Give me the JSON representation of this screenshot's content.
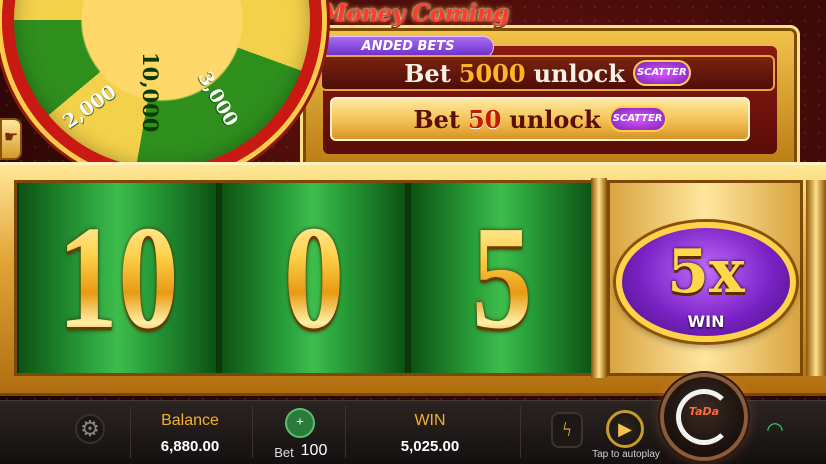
{
  "header": {
    "title": "Money Coming",
    "subtitle": "ANDED BETS"
  },
  "wheel": {
    "segments": [
      "2,000",
      "10,000",
      "3,000"
    ]
  },
  "unlock_rows": [
    {
      "prefix": "Bet",
      "amount": "5000",
      "suffix": "unlock",
      "badge": "SCATTER"
    },
    {
      "prefix": "Bet",
      "amount": "50",
      "suffix": "unlock",
      "badge": "SCATTER"
    }
  ],
  "reels": [
    "10",
    "0",
    "5"
  ],
  "multiplier": {
    "value": "5x",
    "label": "WIN"
  },
  "bottom_bar": {
    "balance_label": "Balance",
    "balance_value": "6,880.00",
    "bet_label": "Bet",
    "bet_value": "100",
    "win_label": "WIN",
    "win_value": "5,025.00",
    "autoplay_label": "Tap to autoplay",
    "spin_logo": "TaDa"
  },
  "icons": {
    "settings": "gear-icon",
    "bet": "coins-icon",
    "turbo": "lightning-icon",
    "autoplay": "autoplay-icon",
    "spin": "spin-icon",
    "network": "wifi-icon"
  },
  "colors": {
    "gold": "#ffd34a",
    "reel_green": "#29a03a",
    "label_gold": "#f3b12b",
    "scatter_purple": "#7e1fb8",
    "wifi_green": "#2fd26a"
  }
}
